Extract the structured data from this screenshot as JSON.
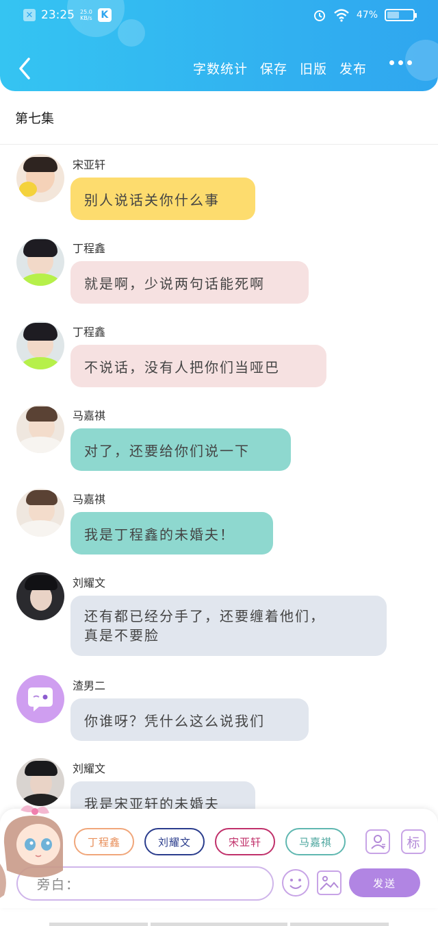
{
  "status_bar": {
    "time": "23:25",
    "net_speed_value": "25.0",
    "net_speed_unit": "KB/s",
    "battery_text": "47%",
    "battery_level": 0.47
  },
  "nav": {
    "actions": [
      "字数统计",
      "保存",
      "旧版",
      "发布"
    ]
  },
  "chapter_title": "第七集",
  "messages": [
    {
      "sender": "宋亚轩",
      "text": "别人说话关你什么事",
      "color": "#fddc6e"
    },
    {
      "sender": "丁程鑫",
      "text": "就是啊，少说两句话能死啊",
      "color": "#f6e1e1"
    },
    {
      "sender": "丁程鑫",
      "text": "不说话，没有人把你们当哑巴",
      "color": "#f6e1e1"
    },
    {
      "sender": "马嘉祺",
      "text": "对了，还要给你们说一下",
      "color": "#8ed8cf"
    },
    {
      "sender": "马嘉祺",
      "text": "我是丁程鑫的未婚夫！",
      "color": "#8ed8cf"
    },
    {
      "sender": "刘耀文",
      "text_lines": [
        "还有都已经分手了，还要缠着他们，",
        "真是不要脸"
      ],
      "color": "#e1e6ee"
    },
    {
      "sender": "渣男二",
      "text": "你谁呀？凭什么这么说我们",
      "color": "#e1e6ee"
    },
    {
      "sender": "刘耀文",
      "text": "我是宋亚轩的未婚夫",
      "color": "#e1e6ee"
    }
  ],
  "characters": [
    {
      "name": "丁程鑫",
      "color": "#f0a67a"
    },
    {
      "name": "刘耀文",
      "color": "#2a3c8c"
    },
    {
      "name": "宋亚轩",
      "color": "#c0306a"
    },
    {
      "name": "马嘉祺",
      "color": "#5fb7b0"
    }
  ],
  "input": {
    "placeholder": "旁白："
  },
  "send_label": "发送",
  "tag_label": "标"
}
